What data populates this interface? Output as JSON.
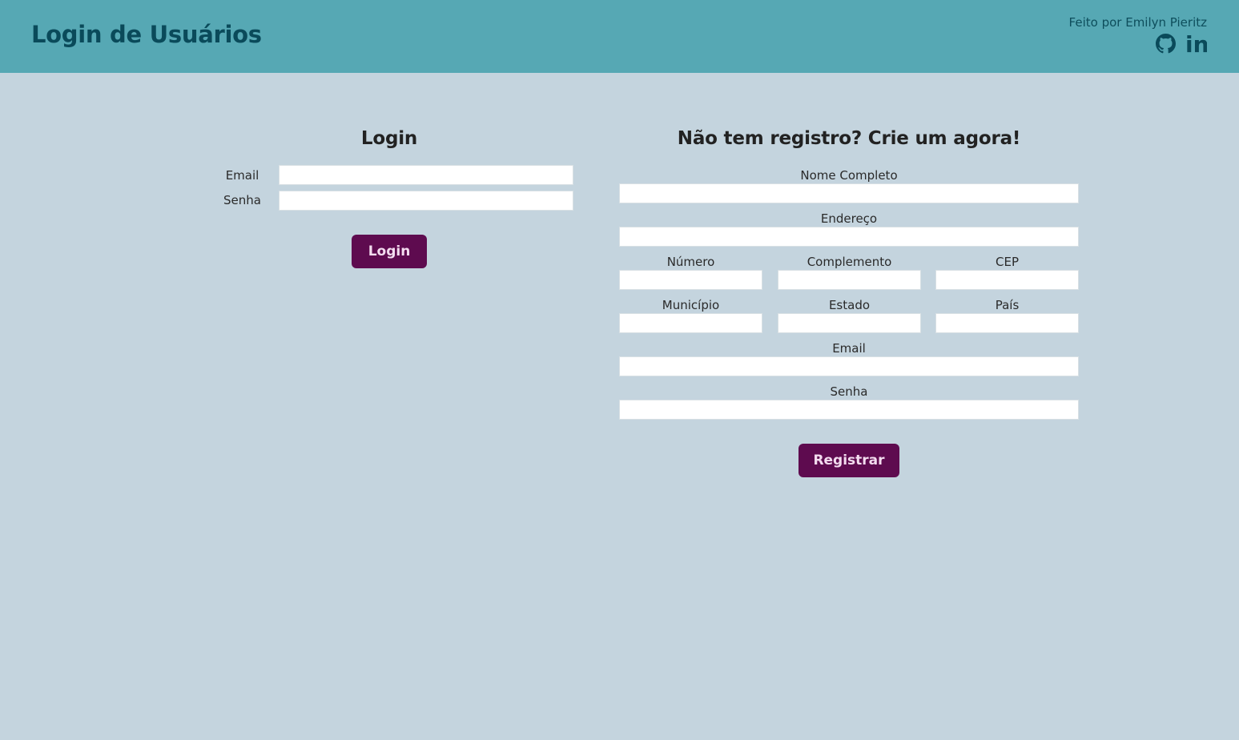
{
  "header": {
    "title": "Login de Usuários",
    "credit": "Feito por Emilyn Pieritz",
    "icons": [
      "github-icon",
      "linkedin-icon"
    ],
    "linkedin_text": "in"
  },
  "login": {
    "title": "Login",
    "email_label": "Email",
    "password_label": "Senha",
    "button_label": "Login"
  },
  "register": {
    "title": "Não tem registro? Crie um agora!",
    "name_label": "Nome Completo",
    "address_label": "Endereço",
    "number_label": "Número",
    "complement_label": "Complemento",
    "cep_label": "CEP",
    "city_label": "Município",
    "state_label": "Estado",
    "country_label": "País",
    "email_label": "Email",
    "password_label": "Senha",
    "button_label": "Registrar"
  },
  "colors": {
    "header_bg": "#56a8b4",
    "page_bg": "#c4d4de",
    "title_color": "#0a4a5a",
    "button_bg": "#5e0b4f"
  }
}
